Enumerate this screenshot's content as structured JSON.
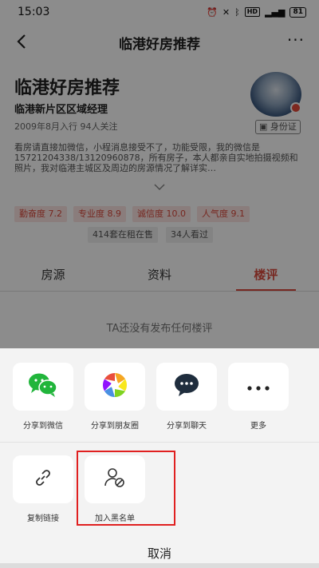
{
  "status_bar": {
    "time": "15:03",
    "battery": "81"
  },
  "nav": {
    "title": "临港好房推荐"
  },
  "profile": {
    "name": "临港好房推荐",
    "role": "临港新片区区域经理",
    "meta": "2009年8月入行  94人关注",
    "id_badge": "身份证",
    "description": "看房请直接加微信，小程消息接受不了，功能受限，我的微信是15721204338/13120960878，所有房子，本人都亲自实地拍摄视频和照片，我对临港主城区及周边的房源情况了解详实…"
  },
  "tags": [
    "勤奋度 7.2",
    "专业度 8.9",
    "诚信度 10.0",
    "人气度 9.1"
  ],
  "stats": [
    "414套在租在售",
    "34人看过"
  ],
  "tabs": [
    "房源",
    "资料",
    "楼评"
  ],
  "empty_text": "TA还没有发布任何楼评",
  "share_items": [
    {
      "label": "分享到微信",
      "icon": "wechat-icon"
    },
    {
      "label": "分享到朋友圈",
      "icon": "moments-icon"
    },
    {
      "label": "分享到聊天",
      "icon": "chat-icon"
    },
    {
      "label": "更多",
      "icon": "more-icon"
    }
  ],
  "actions": [
    {
      "label": "复制链接",
      "icon": "link-icon"
    },
    {
      "label": "加入黑名单",
      "icon": "block-user-icon"
    }
  ],
  "cancel_label": "取消",
  "colors": {
    "accent": "#d9493c",
    "wechat_green": "#21b53b",
    "highlight": "#e02020"
  }
}
